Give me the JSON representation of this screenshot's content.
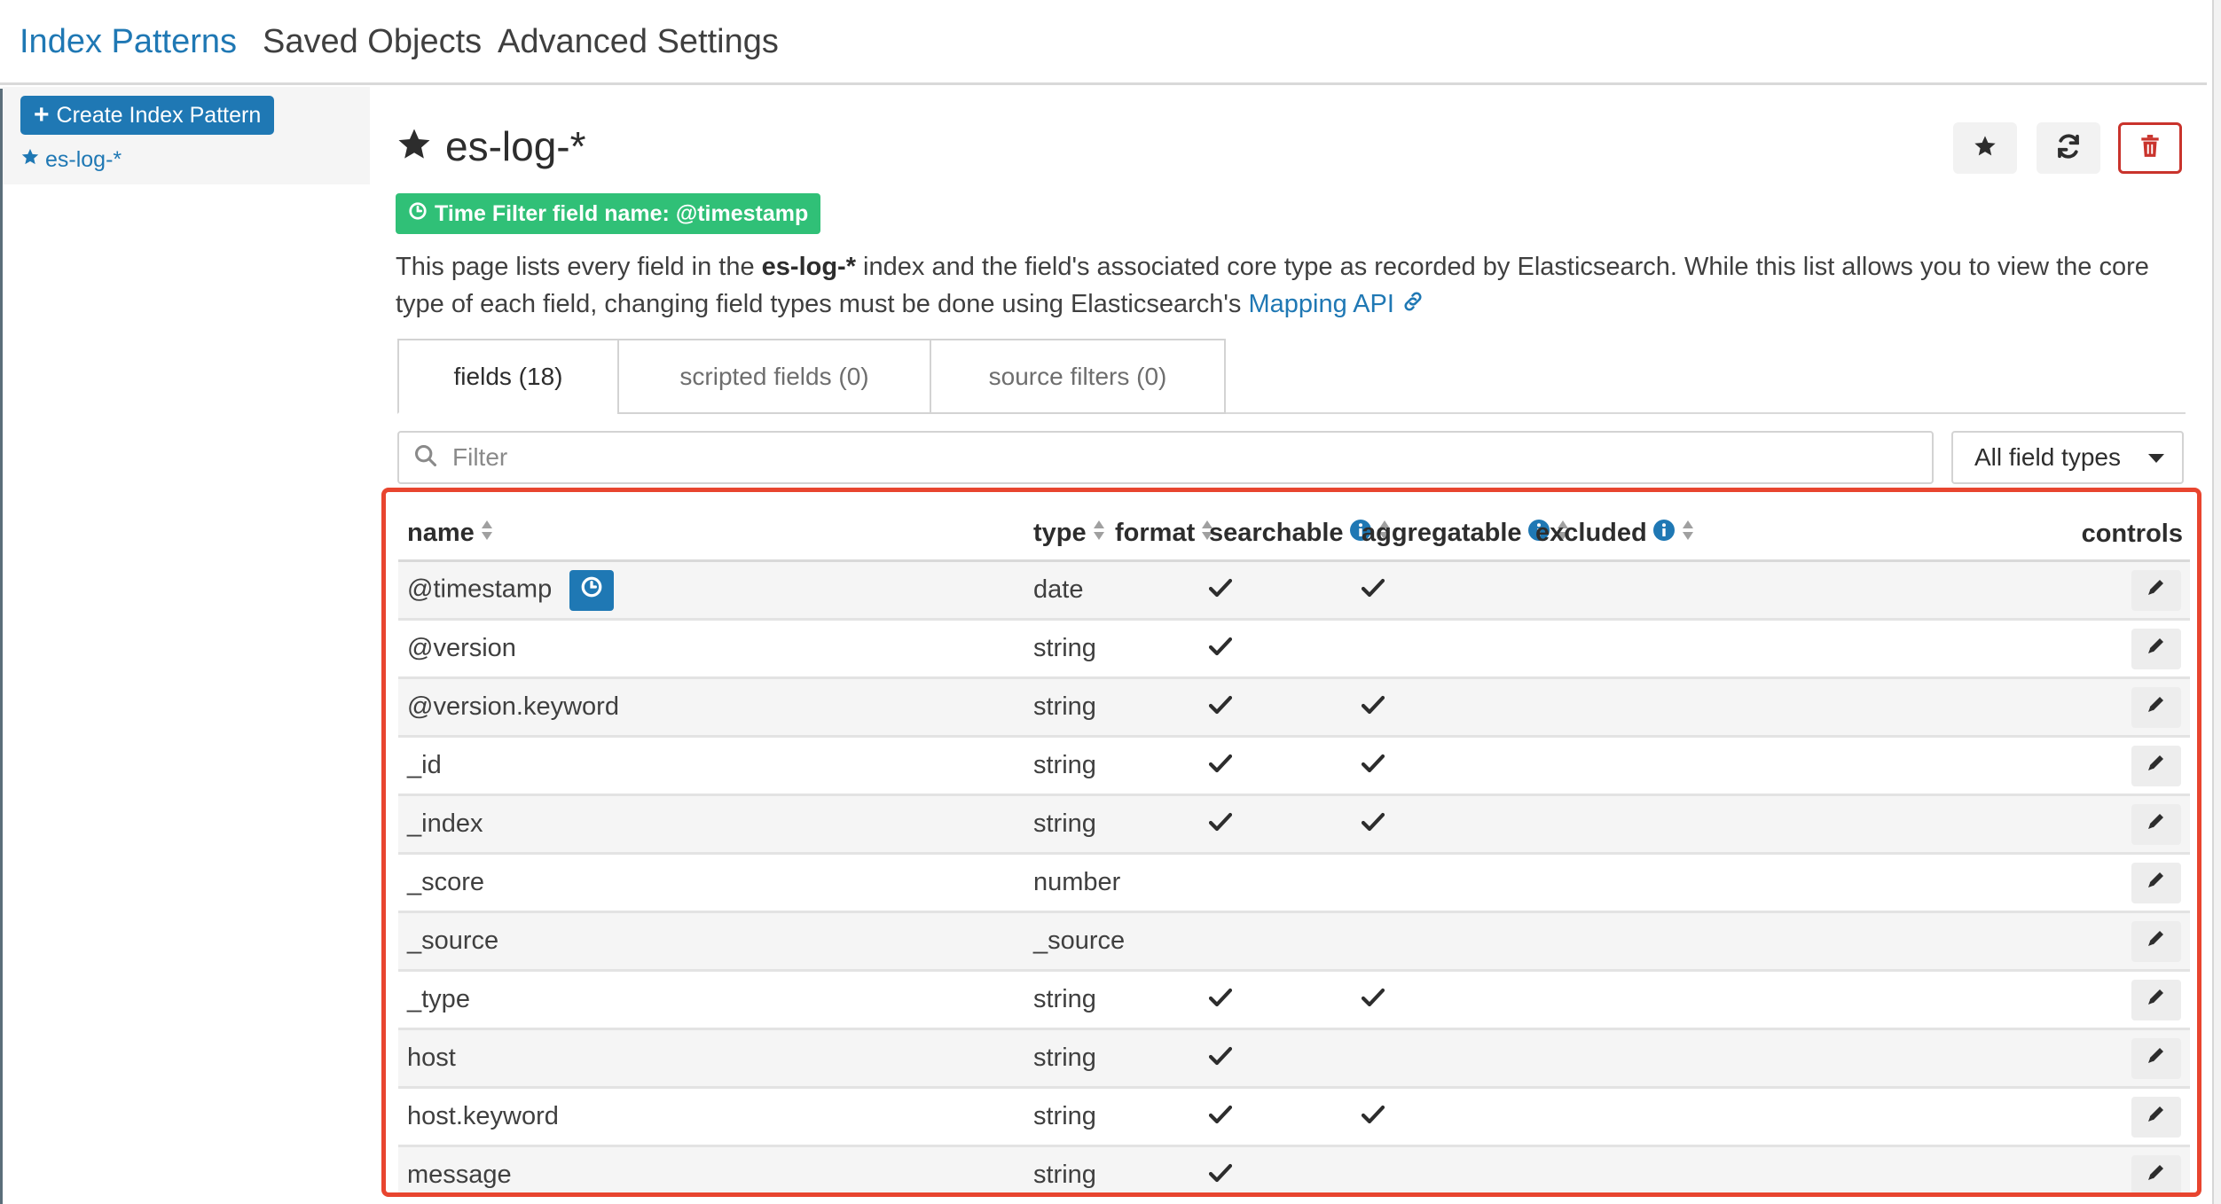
{
  "nav": {
    "tabs": [
      {
        "label": "Index Patterns",
        "active": true
      },
      {
        "label": "Saved Objects",
        "active": false
      },
      {
        "label": "Advanced Settings",
        "active": false
      }
    ]
  },
  "sidebar": {
    "create_label": "Create Index Pattern",
    "patterns": [
      {
        "label": "es-log-*",
        "icon": "star-icon"
      }
    ]
  },
  "header": {
    "title": "es-log-*",
    "time_filter": "Time Filter field name: @timestamp",
    "actions": [
      "set-default-star-icon",
      "refresh-icon",
      "trash-icon"
    ]
  },
  "description": {
    "part1": "This page lists every field in the ",
    "index_name": "es-log-*",
    "part2": " index and the field's associated core type as recorded by Elasticsearch. While this list allows you to view the core type of each field, changing field types must be done using Elasticsearch's ",
    "link": "Mapping API"
  },
  "subtabs": [
    {
      "label": "fields (18)",
      "active": true
    },
    {
      "label": "scripted fields (0)",
      "active": false
    },
    {
      "label": "source filters (0)",
      "active": false
    }
  ],
  "filter": {
    "placeholder": "Filter",
    "value": ""
  },
  "type_select": {
    "selected": "All field types"
  },
  "table": {
    "columns": [
      "name",
      "type",
      "format",
      "searchable",
      "aggregatable",
      "excluded",
      "controls"
    ],
    "rows": [
      {
        "name": "@timestamp",
        "type": "date",
        "searchable": true,
        "aggregatable": true,
        "time_field": true
      },
      {
        "name": "@version",
        "type": "string",
        "searchable": true,
        "aggregatable": false
      },
      {
        "name": "@version.keyword",
        "type": "string",
        "searchable": true,
        "aggregatable": true
      },
      {
        "name": "_id",
        "type": "string",
        "searchable": true,
        "aggregatable": true
      },
      {
        "name": "_index",
        "type": "string",
        "searchable": true,
        "aggregatable": true
      },
      {
        "name": "_score",
        "type": "number",
        "searchable": false,
        "aggregatable": false
      },
      {
        "name": "_source",
        "type": "_source",
        "searchable": false,
        "aggregatable": false
      },
      {
        "name": "_type",
        "type": "string",
        "searchable": true,
        "aggregatable": true
      },
      {
        "name": "host",
        "type": "string",
        "searchable": true,
        "aggregatable": false
      },
      {
        "name": "host.keyword",
        "type": "string",
        "searchable": true,
        "aggregatable": true
      },
      {
        "name": "message",
        "type": "string",
        "searchable": true,
        "aggregatable": false
      }
    ]
  },
  "colors": {
    "accent": "#1f78b4",
    "success": "#30c077",
    "danger": "#c9332c",
    "highlight_frame": "#e8452f"
  }
}
